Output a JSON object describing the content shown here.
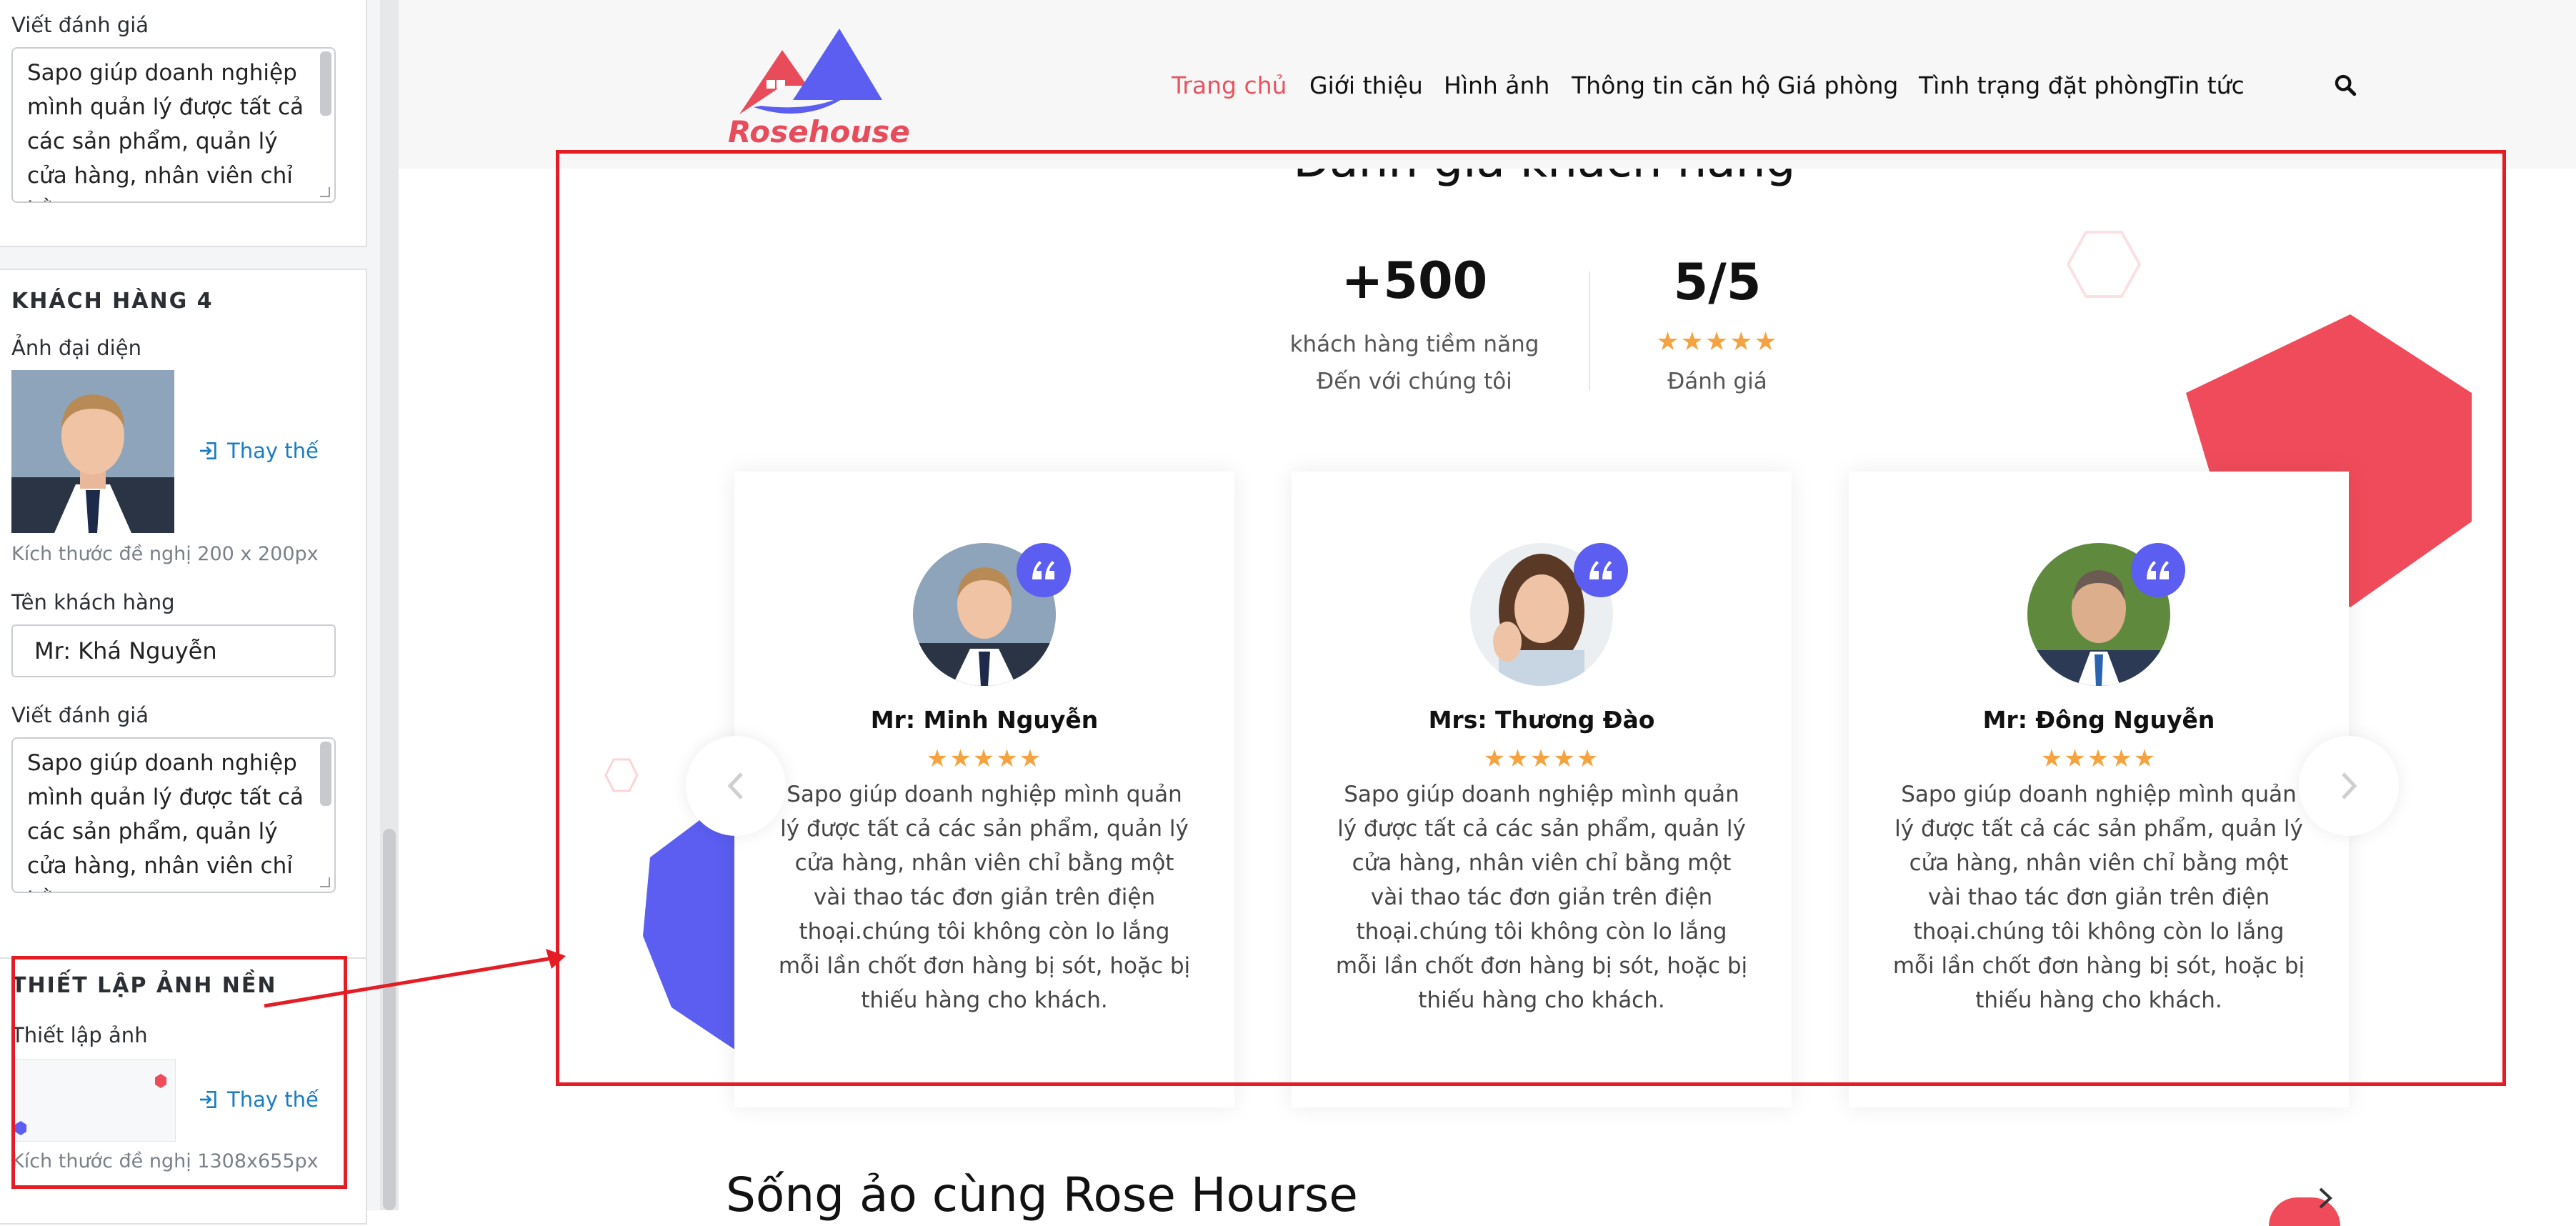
{
  "sidebar": {
    "review_label_top": "Viết đánh giá",
    "review_text_top": "Sapo giúp doanh nghiệp mình quản lý được tất cả các sản phẩm, quản lý cửa hàng, nhân viên chỉ bằng",
    "customer4": {
      "title": "KHÁCH HÀNG 4",
      "avatar_label": "Ảnh đại diện",
      "replace_label": "Thay thế",
      "size_hint": "Kích thước đề nghị 200 x 200px",
      "name_label": "Tên khách hàng",
      "name_value": "Mr: Khá Nguyễn",
      "review_label": "Viết đánh giá",
      "review_text": "Sapo giúp doanh nghiệp mình quản lý được tất cả các sản phẩm, quản lý cửa hàng, nhân viên chỉ bằng"
    },
    "background": {
      "title": "THIẾT LẬP ẢNH NỀN",
      "image_label": "Thiết lập ảnh",
      "replace_label": "Thay thế",
      "size_hint": "Kích thước đề nghị 1308x655px"
    }
  },
  "header": {
    "logo_text": "Rosehouse",
    "nav": [
      "Trang chủ",
      "Giới thiệu",
      "Hình ảnh",
      "Thông tin căn hộ",
      "Giá phòng",
      "Tình trạng đặt phòng",
      "Tin tức"
    ],
    "active_index": 0,
    "search_icon": "search-icon"
  },
  "reviews": {
    "section_title": "Đánh giá khách hàng",
    "stats": [
      {
        "value": "+500",
        "line1": "khách hàng tiềm năng",
        "line2": "Đến với chúng tôi"
      },
      {
        "value": "5/5",
        "stars": "★★★★★",
        "line1": "Đánh giá"
      }
    ],
    "cards": [
      {
        "name": "Mr: Minh Nguyễn",
        "stars": "★★★★★",
        "text": "Sapo giúp doanh nghiệp mình quản lý được tất cả các sản phẩm, quản lý cửa hàng, nhân viên chỉ bằng một vài thao tác đơn giản trên điện thoại.chúng tôi không còn lo lắng mỗi lần chốt đơn hàng bị sót, hoặc bị thiếu hàng cho khách."
      },
      {
        "name": "Mrs: Thương Đào",
        "stars": "★★★★★",
        "text": "Sapo giúp doanh nghiệp mình quản lý được tất cả các sản phẩm, quản lý cửa hàng, nhân viên chỉ bằng một vài thao tác đơn giản trên điện thoại.chúng tôi không còn lo lắng mỗi lần chốt đơn hàng bị sót, hoặc bị thiếu hàng cho khách."
      },
      {
        "name": "Mr: Đông Nguyễn",
        "stars": "★★★★★",
        "text": "Sapo giúp doanh nghiệp mình quản lý được tất cả các sản phẩm, quản lý cửa hàng, nhân viên chỉ bằng một vài thao tác đơn giản trên điện thoại.chúng tôi không còn lo lắng mỗi lần chốt đơn hàng bị sót, hoặc bị thiếu hàng cho khách."
      }
    ],
    "prev_icon": "chevron-left-icon",
    "next_icon": "chevron-right-icon"
  },
  "next_section_title": "Sống ảo cùng Rose Hourse",
  "colors": {
    "accent_red": "#f04b5b",
    "accent_blue": "#5b5ef0",
    "nav_active": "#e9545f",
    "star": "#f4a340",
    "annotation_red": "#e41c24",
    "link_blue": "#1a7cc4"
  }
}
